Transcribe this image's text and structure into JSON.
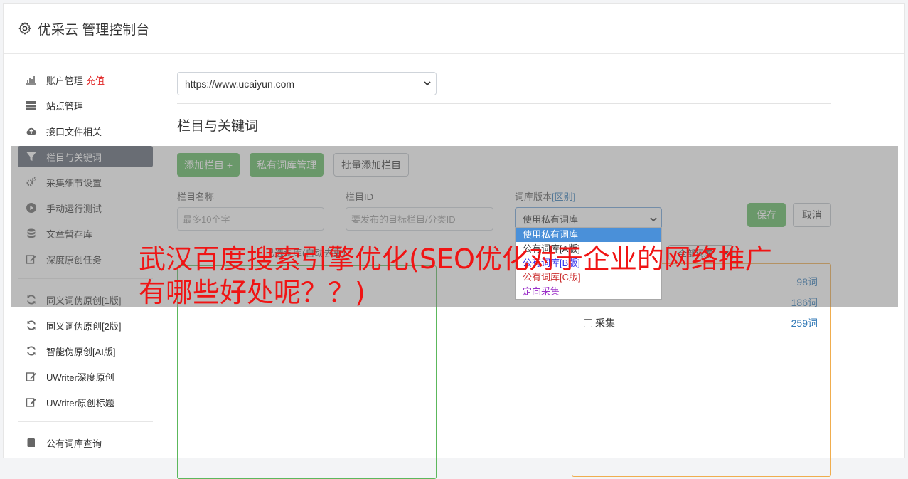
{
  "header": {
    "title": "优采云 管理控制台",
    "icon": "gear-icon"
  },
  "sidebar": {
    "items": [
      {
        "label": "账户管理",
        "badge": "充值",
        "icon": "bar-chart-icon"
      },
      {
        "label": "站点管理",
        "icon": "server-icon"
      },
      {
        "label": "接口文件相关",
        "icon": "cloud-upload-icon"
      },
      {
        "label": "栏目与关键词",
        "icon": "filter-icon",
        "active": true
      },
      {
        "label": "采集细节设置",
        "icon": "cogs-icon"
      },
      {
        "label": "手动运行测试",
        "icon": "play-circle-icon"
      },
      {
        "label": "文章暂存库",
        "icon": "database-icon"
      },
      {
        "label": "深度原创任务",
        "icon": "edit-icon"
      }
    ],
    "items2": [
      {
        "label": "同义词伪原创[1版]",
        "icon": "refresh-icon"
      },
      {
        "label": "同义词伪原创[2版]",
        "icon": "refresh-icon"
      },
      {
        "label": "智能伪原创[AI版]",
        "icon": "refresh-icon"
      },
      {
        "label": "UWriter深度原创",
        "icon": "edit-icon"
      },
      {
        "label": "UWriter原创标题",
        "icon": "edit-icon"
      }
    ],
    "items3": [
      {
        "label": "公有词库查询",
        "icon": "book-icon"
      }
    ]
  },
  "main": {
    "site_select": "https://www.ucaiyun.com",
    "section_title": "栏目与关键词",
    "buttons": {
      "add_column": "添加栏目 +",
      "private_lib": "私有词库管理",
      "batch_add": "批量添加栏目"
    },
    "form": {
      "col_name_label": "栏目名称",
      "col_name_placeholder": "最多10个字",
      "col_id_label": "栏目ID",
      "col_id_placeholder": "要发布的目标栏目/分类ID",
      "lib_version_label": "词库版本",
      "lib_version_link": "[区别]",
      "lib_version_value": "使用私有词库",
      "save": "保存",
      "cancel": "取消"
    },
    "dropdown_options": [
      "使用私有词库",
      "公有词库[A版]",
      "公有词库[B版]",
      "公有词库[C版]",
      "定向采集"
    ],
    "lists_label": "已选词库(自动去重)",
    "lib_filter": "全部词库",
    "lib_rows": [
      {
        "name": "",
        "count": "98词"
      },
      {
        "name": "",
        "count": "186词"
      },
      {
        "name": "采集",
        "count": "259词"
      }
    ]
  },
  "promo": {
    "text": "武汉百度搜索引擎优化(SEO优化对于企业的网络推广有哪些好处呢？？)"
  },
  "colors": {
    "accent_green": "#5cb85c",
    "active_nav": "#5a6270",
    "promo_red": "#f01414",
    "link_blue": "#337ab7"
  }
}
